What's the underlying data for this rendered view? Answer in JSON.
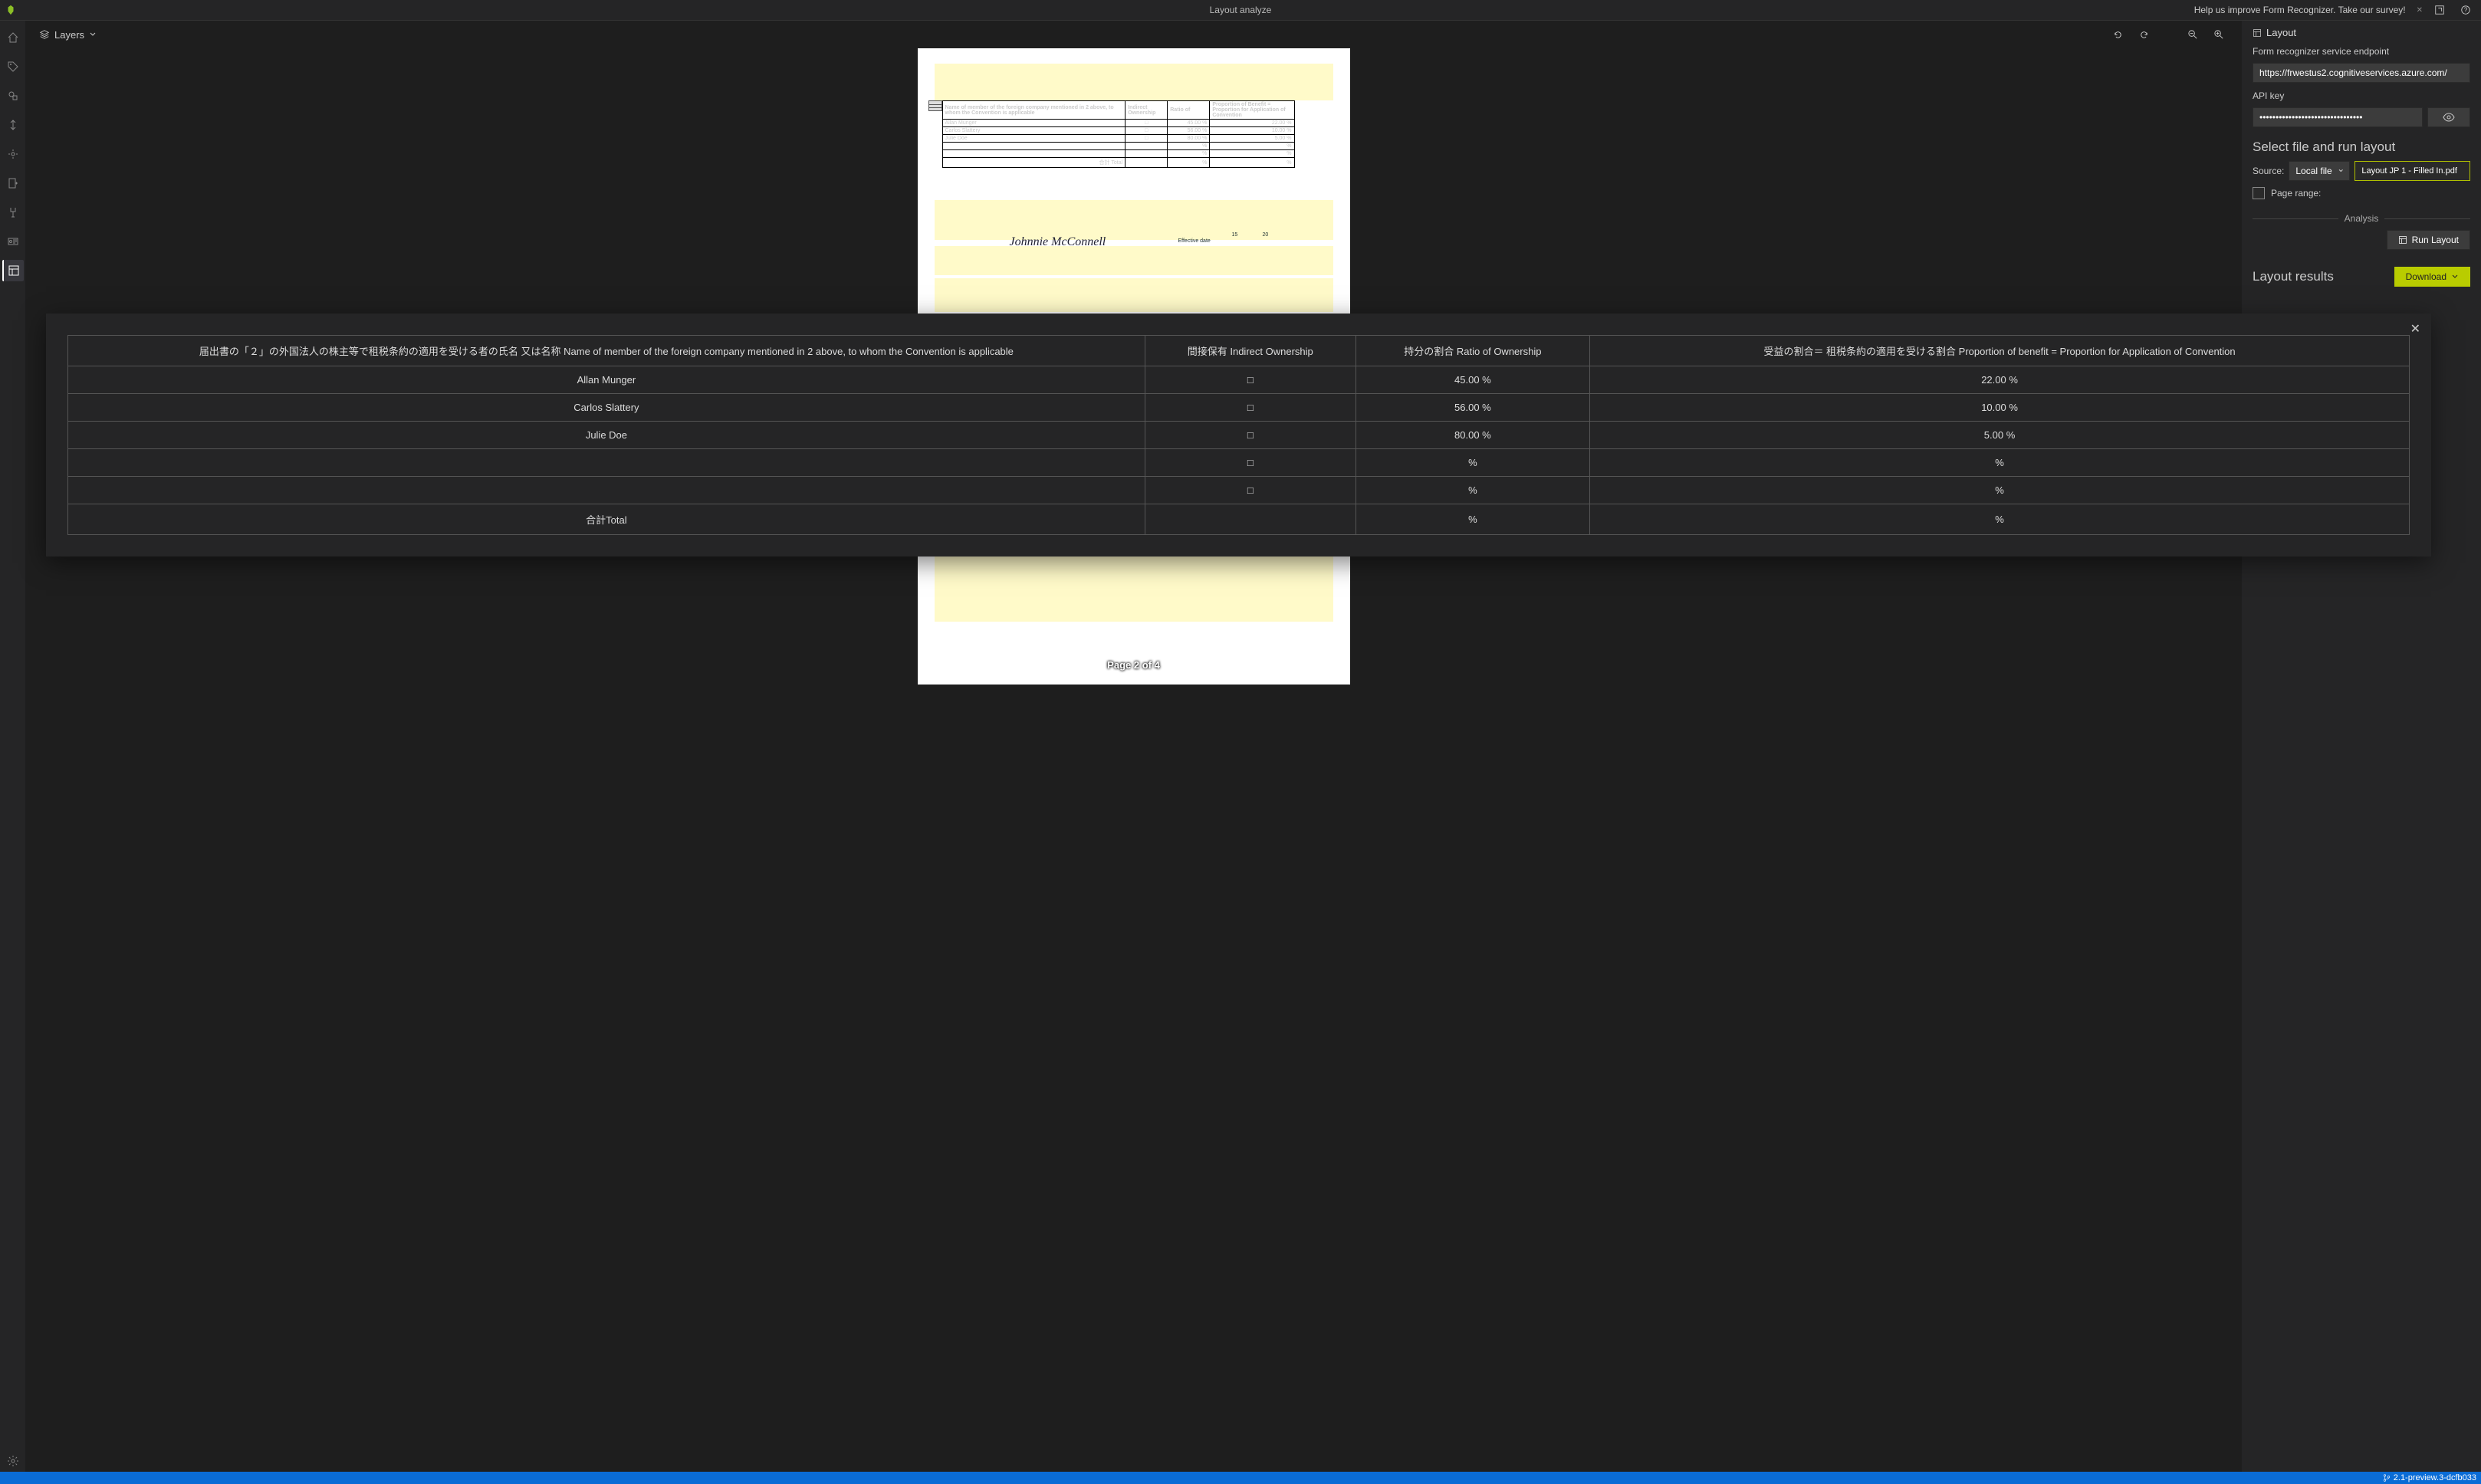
{
  "app": {
    "title": "Layout analyze",
    "survey_text": "Help us improve Form Recognizer. Take our survey!"
  },
  "leftnav": {
    "items": [
      {
        "name": "home-icon"
      },
      {
        "name": "tag-icon"
      },
      {
        "name": "shapes-icon"
      },
      {
        "name": "compose-icon"
      },
      {
        "name": "train-icon"
      },
      {
        "name": "add-doc-icon"
      },
      {
        "name": "connect-icon"
      },
      {
        "name": "card-icon"
      },
      {
        "name": "layout-icon"
      }
    ],
    "settings": "settings"
  },
  "canvas": {
    "layers_label": "Layers",
    "page_indicator": "Page 2 of 4",
    "miniTable": {
      "headers": [
        "Name of member of the foreign company mentioned in 2 above, to whom the Convention is applicable",
        "Indirect Ownership",
        "Ratio of",
        "Proportion of Benefit = Proportion for Application of Convention"
      ],
      "rows": [
        [
          "Allan Munger",
          "□",
          "45.00 %",
          "22.00 %"
        ],
        [
          "Carlos Slattery",
          "□",
          "56.00 %",
          "10.00 %"
        ],
        [
          "Julie Doe",
          "□",
          "80.00 %",
          "5.00 %"
        ],
        [
          "",
          "",
          "%",
          "%"
        ],
        [
          "",
          "",
          "%",
          "%"
        ],
        [
          "合計 Total",
          "",
          "%",
          "%"
        ]
      ]
    },
    "signature": "Johnnie McConnell",
    "eff_label": "Effective date",
    "eff_date_y": "15",
    "eff_date_m": "20"
  },
  "rightpanel": {
    "layout_heading": "Layout",
    "endpoint_label": "Form recognizer service endpoint",
    "endpoint_value": "https://frwestus2.cognitiveservices.azure.com/",
    "apikey_label": "API key",
    "apikey_value": "••••••••••••••••••••••••••••••••",
    "select_file_heading": "Select file and run layout",
    "source_label": "Source:",
    "source_value": "Local file",
    "file_name": "Layout JP 1 - Filled In.pdf",
    "page_range_label": "Page range:",
    "analysis_label": "Analysis",
    "run_layout_label": "Run Layout",
    "results_heading": "Layout results",
    "download_label": "Download"
  },
  "modal": {
    "headers": {
      "c1": "届出書の「２」の外国法人の株主等で租税条約の適用を受ける者の氏名 又は名称 Name of member of the foreign company mentioned in 2 above, to whom the Convention is applicable",
      "c2": "間接保有 Indirect Ownership",
      "c3": "持分の割合 Ratio of Ownership",
      "c4": "受益の割合＝ 租税条約の適用を受ける割合 Proportion of benefit = Proportion for Application of Convention"
    },
    "rows": [
      {
        "name": "Allan Munger",
        "indirect": "□",
        "ratio": "45.00 %",
        "benefit": "22.00 %"
      },
      {
        "name": "Carlos Slattery",
        "indirect": "□",
        "ratio": "56.00 %",
        "benefit": "10.00 %"
      },
      {
        "name": "Julie Doe",
        "indirect": "□",
        "ratio": "80.00 %",
        "benefit": "5.00 %"
      },
      {
        "name": "",
        "indirect": "□",
        "ratio": "%",
        "benefit": "%"
      },
      {
        "name": "",
        "indirect": "□",
        "ratio": "%",
        "benefit": "%"
      },
      {
        "name": "合計Total",
        "indirect": "",
        "ratio": "%",
        "benefit": "%"
      }
    ]
  },
  "statusbar": {
    "version": "2.1-preview.3-dcfb033"
  }
}
